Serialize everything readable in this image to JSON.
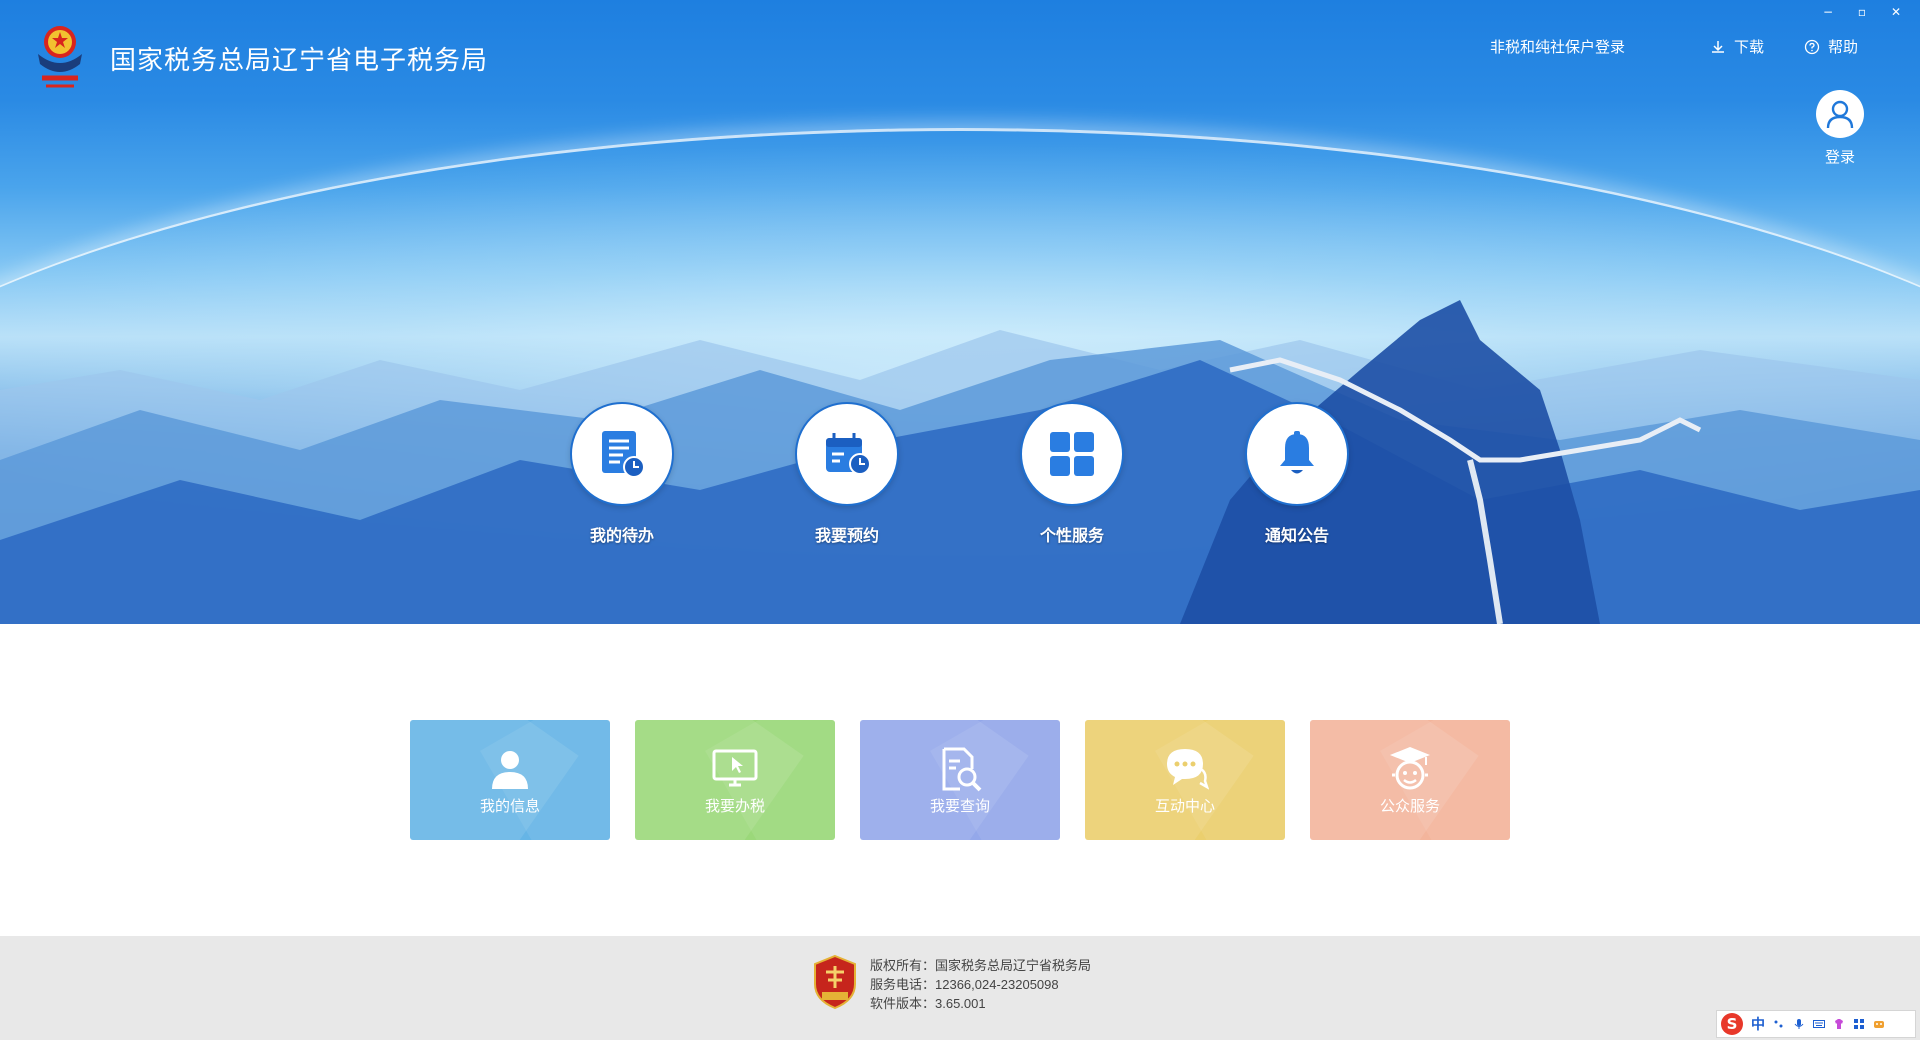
{
  "header": {
    "title": "国家税务总局辽宁省电子税务局",
    "links": {
      "non_tax_login": "非税和纯社保户登录",
      "download": "下载",
      "help": "帮助"
    },
    "login_label": "登录"
  },
  "window_controls": {
    "minimize": "−",
    "maximize": "▫",
    "close": "✕"
  },
  "quick_nav": [
    {
      "label": "我的待办",
      "icon": "todo-clock-icon"
    },
    {
      "label": "我要预约",
      "icon": "calendar-clock-icon"
    },
    {
      "label": "个性服务",
      "icon": "grid-apps-icon"
    },
    {
      "label": "通知公告",
      "icon": "bell-icon"
    }
  ],
  "tiles": [
    {
      "label": "我的信息",
      "icon": "user-icon",
      "color": "#66b5e6"
    },
    {
      "label": "我要办税",
      "icon": "monitor-cursor-icon",
      "color": "#9bd87a"
    },
    {
      "label": "我要查询",
      "icon": "document-search-icon",
      "color": "#94a8ea"
    },
    {
      "label": "互动中心",
      "icon": "chat-bubble-icon",
      "color": "#ebcf6e"
    },
    {
      "label": "公众服务",
      "icon": "graduate-face-icon",
      "color": "#f3b59c"
    }
  ],
  "footer": {
    "copyright": "版权所有：国家税务总局辽宁省税务局",
    "phone": "服务电话：12366,024-23205098",
    "version": "软件版本：3.65.001"
  },
  "ime": {
    "brand_letter": "S",
    "mode": "中"
  },
  "colors": {
    "brand_blue": "#1e7fe0",
    "footer_bg": "#e8e8e8"
  }
}
